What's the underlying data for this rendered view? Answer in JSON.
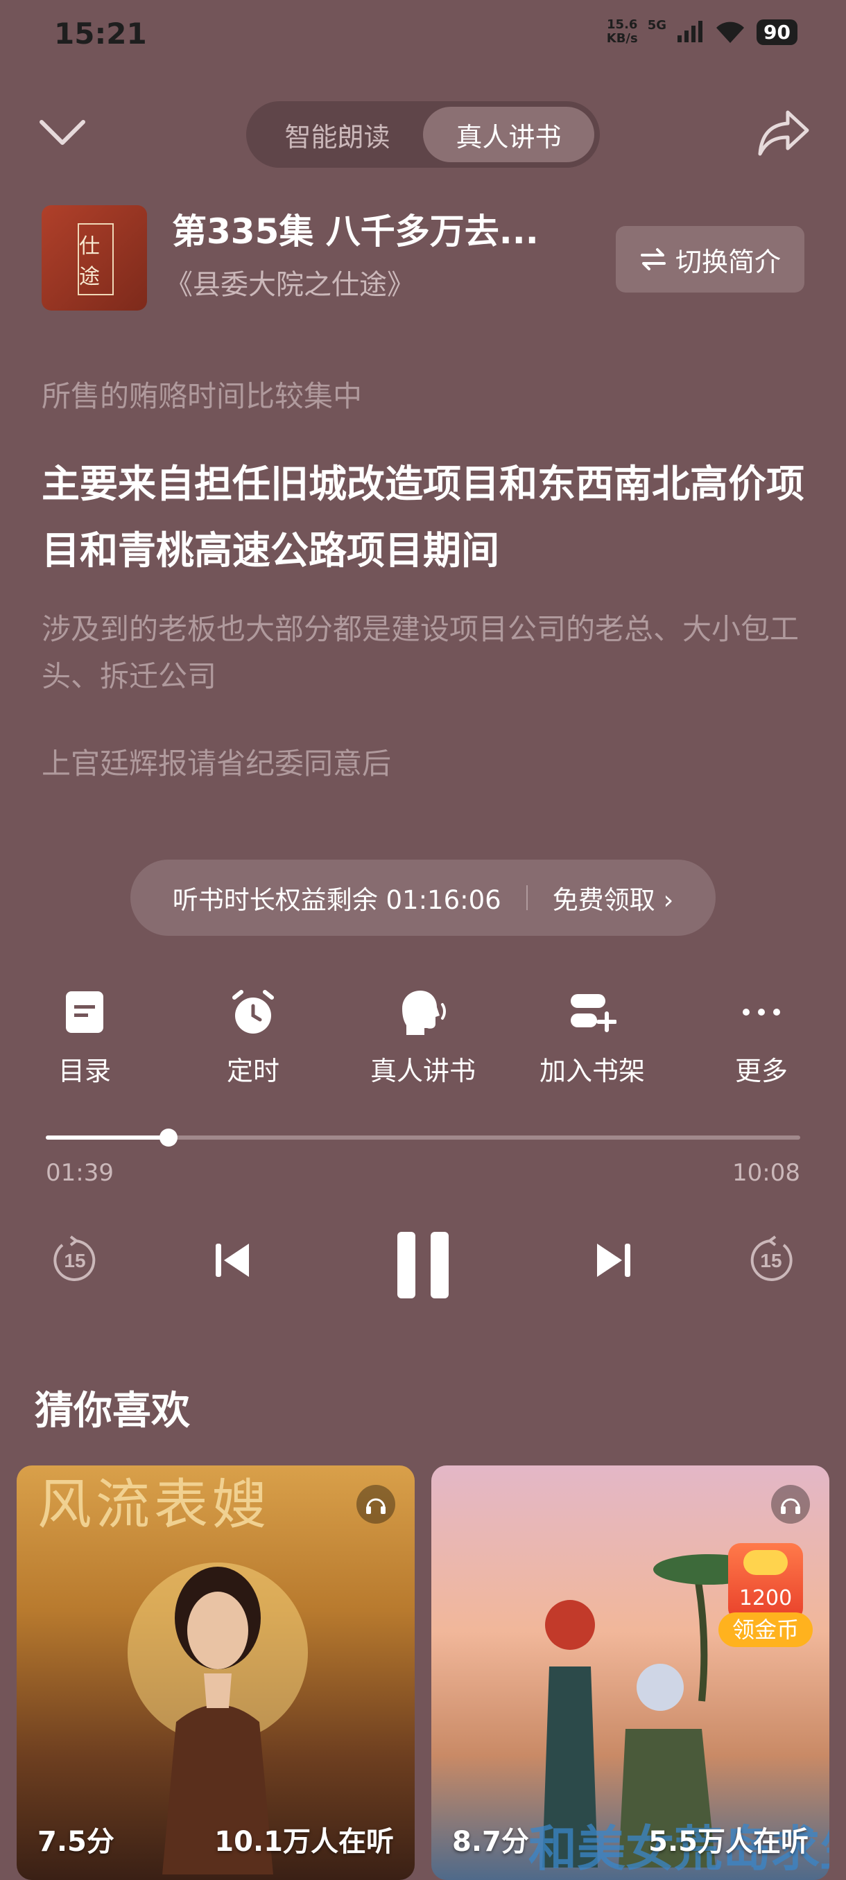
{
  "status": {
    "time": "15:21",
    "speed_value": "15.6",
    "speed_unit": "KB/s",
    "network": "5G",
    "battery": "90"
  },
  "header": {
    "mode_ai": "智能朗读",
    "mode_human": "真人讲书"
  },
  "book": {
    "cover_text": "仕途",
    "episode_title": "第335集 八千多万去...",
    "book_title": "《县委大院之仕途》",
    "switch_label": "切换简介"
  },
  "content": {
    "line1": "所售的贿赂时间比较集中",
    "line2": "主要来自担任旧城改造项目和东西南北高价项目和青桃高速公路项目期间",
    "line3": "涉及到的老板也大部分都是建设项目公司的老总、大小包工头、拆迁公司",
    "line4": "上官廷辉报请省纪委同意后"
  },
  "benefit": {
    "text": "听书时长权益剩余 01:16:06",
    "claim": "免费领取 ›"
  },
  "actions": [
    {
      "label": "目录",
      "icon": "catalog-icon"
    },
    {
      "label": "定时",
      "icon": "alarm-clock-icon"
    },
    {
      "label": "真人讲书",
      "icon": "speaking-head-icon"
    },
    {
      "label": "加入书架",
      "icon": "add-bookshelf-icon"
    },
    {
      "label": "更多",
      "icon": "more-dots-icon"
    }
  ],
  "player": {
    "current": "01:39",
    "total": "10:08",
    "progress": 0.163,
    "rewind": "15",
    "forward": "15"
  },
  "recommend": {
    "title": "猜你喜欢",
    "cards": [
      {
        "cover_title": "风流表嫂",
        "score": "7.5分",
        "listeners": "10.1万人在听"
      },
      {
        "cover_title": "和美女荒岛求生",
        "score": "8.7分",
        "listeners": "5.5万人在听",
        "coin_amount": "1200",
        "coin_label": "领金币"
      }
    ]
  },
  "colors": {
    "background": "#735559",
    "pill": "#876c70",
    "text_dim": "#b09a9d"
  }
}
